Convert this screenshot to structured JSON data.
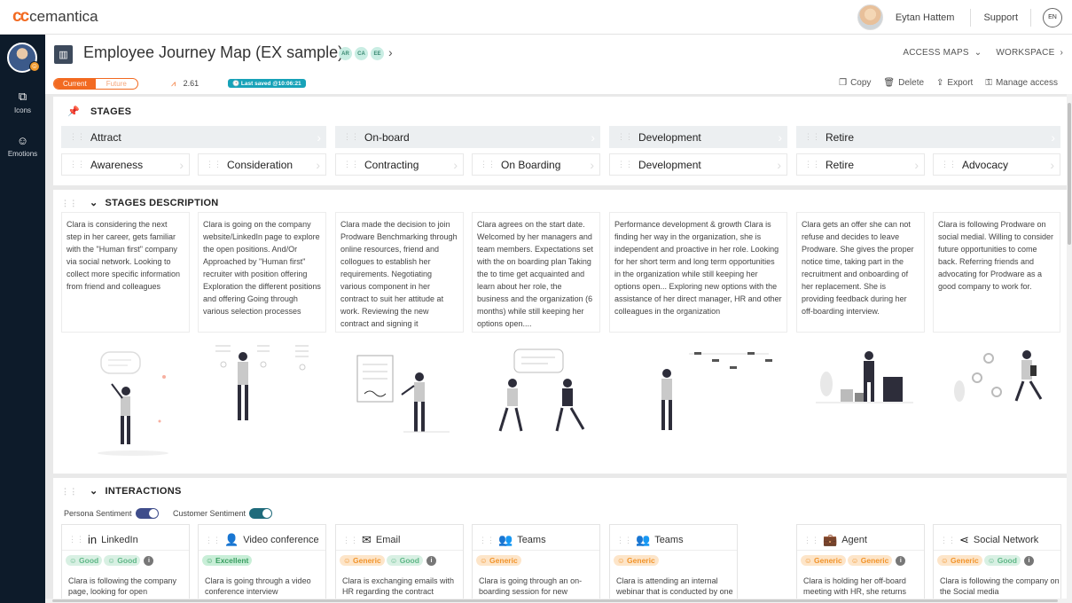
{
  "app": {
    "logo_mark": "ϲϲ",
    "logo_text": "cemantica"
  },
  "topbar": {
    "user_name": "Eytan Hattem",
    "support": "Support",
    "lang": "EN"
  },
  "sidebar": {
    "items": [
      {
        "label": "Icons"
      },
      {
        "label": "Emotions"
      }
    ]
  },
  "header": {
    "title": "Employee Journey Map (EX sample)",
    "chips": [
      "AR",
      "CA",
      "EE"
    ],
    "access_maps": "ACCESS MAPS",
    "workspace": "WORKSPACE"
  },
  "toolbar": {
    "toggle_current": "Current",
    "toggle_future": "Future",
    "score": "2.61",
    "last_saved": "Last saved @10:06:21",
    "actions": [
      "Copy",
      "Delete",
      "Export",
      "Manage access"
    ]
  },
  "stages": {
    "title": "STAGES",
    "top": [
      "Attract",
      "On-board",
      "Development",
      "Retire"
    ],
    "sub": [
      "Awareness",
      "Consideration",
      "Contracting",
      "On Boarding",
      "Development",
      "Retire",
      "Advocacy"
    ]
  },
  "stages_description": {
    "title": "STAGES DESCRIPTION",
    "items": [
      "Clara is considering the next step in her career, gets familiar with the \"Human first\" company via social network. Looking to collect more specific information from friend and colleagues",
      "Clara is going on the company website/LinkedIn page to explore the open positions. And/Or Approached by \"Human first\" recruiter with position offering Exploration the different positions and offering Going through various selection processes",
      "Clara made the decision to join Prodware Benchmarking through online resources, friend and collogues to establish her requirements. Negotiating various component in her contract to suit her attitude at work. Reviewing the new contract and signing it",
      "Clara agrees on the start date. Welcomed by her managers and team members. Expectations set with the on boarding plan Taking the to time get acquainted and learn about her role, the business and the organization (6 months) while still keeping her options open....",
      "Performance development & growth Clara is finding her way in the organization, she is independent and proactive in her role. Looking for her short term and long term opportunities in the organization while still keeping her options open... Exploring new options with the assistance of her direct manager, HR and other colleagues in the organization",
      "Clara gets an offer she can not refuse and decides to leave Prodware. She gives the proper notice time, taking part in the recruitment and onboarding of her replacement. She is providing feedback during her off-boarding interview.",
      "Clara is following Prodware on social medial. Willing to consider future opportunities to come back. Referring friends and advocating for Prodware as a good company to work for."
    ]
  },
  "interactions": {
    "title": "INTERACTIONS",
    "persona_sentiment": "Persona Sentiment",
    "customer_sentiment": "Customer Sentiment",
    "cards": [
      {
        "title": "LinkedIn",
        "icon": "linkedin-icon",
        "badges": [
          {
            "label": "Good",
            "kind": "good"
          },
          {
            "label": "Good",
            "kind": "good"
          }
        ],
        "info": true,
        "text": "Clara is following the company page, looking for open"
      },
      {
        "title": "Video conference",
        "icon": "video-conference-icon",
        "badges": [
          {
            "label": "Excellent",
            "kind": "exc"
          }
        ],
        "info": false,
        "text": "Clara is going through a video conference interview"
      },
      {
        "title": "Email",
        "icon": "email-icon",
        "badges": [
          {
            "label": "Generic",
            "kind": "gen"
          },
          {
            "label": "Good",
            "kind": "good"
          }
        ],
        "info": true,
        "text": "Clara is exchanging emails with HR regarding the contract"
      },
      {
        "title": "Teams",
        "icon": "teams-icon",
        "badges": [
          {
            "label": "Generic",
            "kind": "gen"
          }
        ],
        "info": false,
        "text": "Clara is going through an on-boarding session for new"
      },
      {
        "title": "Teams",
        "icon": "teams-icon",
        "badges": [
          {
            "label": "Generic",
            "kind": "gen"
          }
        ],
        "info": false,
        "text": "Clara is attending an internal webinar that is conducted by one of the experts working at"
      },
      {
        "title": "Agent",
        "icon": "agent-icon",
        "badges": [
          {
            "label": "Generic",
            "kind": "gen"
          },
          {
            "label": "Generic",
            "kind": "gen"
          }
        ],
        "info": true,
        "text": "Clara is holding her off-board meeting with HR, she returns"
      },
      {
        "title": "Social Network",
        "icon": "share-icon",
        "badges": [
          {
            "label": "Generic",
            "kind": "gen"
          },
          {
            "label": "Good",
            "kind": "good"
          }
        ],
        "info": true,
        "text": "Clara is following the company on the Social media"
      }
    ]
  }
}
